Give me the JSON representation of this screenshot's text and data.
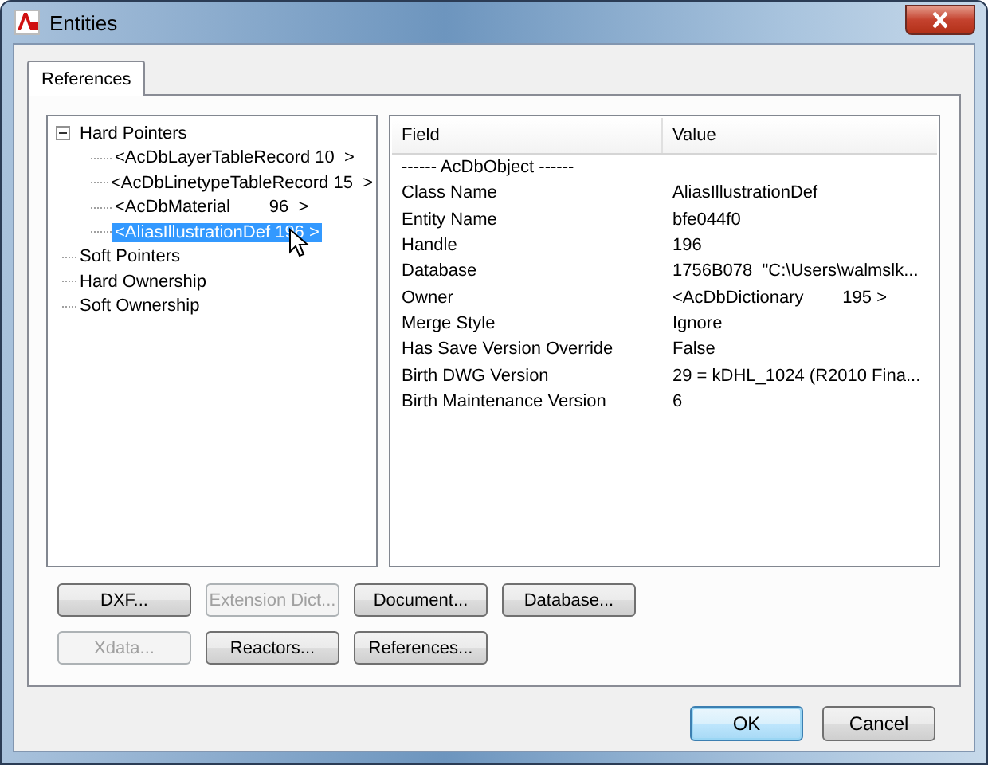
{
  "window": {
    "title": "Entities"
  },
  "tabs": [
    {
      "label": "References",
      "selected": true
    }
  ],
  "tree": [
    {
      "label": "Hard Pointers",
      "expanded": true,
      "selected": false,
      "children": [
        {
          "label": "<AcDbLayerTableRecord 10  >",
          "selected": false
        },
        {
          "label": "<AcDbLinetypeTableRecord 15  >",
          "selected": false
        },
        {
          "label": "<AcDbMaterial        96  >",
          "selected": false
        },
        {
          "label": "<AliasIllustrationDef 196 >",
          "selected": true
        }
      ]
    },
    {
      "label": "Soft Pointers",
      "selected": false
    },
    {
      "label": "Hard Ownership",
      "selected": false
    },
    {
      "label": "Soft Ownership",
      "selected": false
    }
  ],
  "table": {
    "columns": [
      "Field",
      "Value"
    ],
    "rows": [
      {
        "kind": "section",
        "cells": [
          "------ AcDbObject ------"
        ]
      },
      {
        "kind": "pair",
        "cells": [
          "Class Name",
          "AliasIllustrationDef"
        ]
      },
      {
        "kind": "pair",
        "cells": [
          "Entity Name",
          "bfe044f0"
        ]
      },
      {
        "kind": "pair",
        "cells": [
          "Handle",
          "196"
        ]
      },
      {
        "kind": "pair",
        "cells": [
          "Database",
          "1756B078  \"C:\\Users\\walmslk..."
        ]
      },
      {
        "kind": "pair",
        "cells": [
          "Owner",
          "<AcDbDictionary        195 >"
        ]
      },
      {
        "kind": "pair",
        "cells": [
          "Merge Style",
          "Ignore"
        ]
      },
      {
        "kind": "pair",
        "cells": [
          "Has Save Version Override",
          "False"
        ]
      },
      {
        "kind": "pair",
        "cells": [
          "Birth DWG Version",
          "29 = kDHL_1024 (R2010 Fina..."
        ]
      },
      {
        "kind": "pair",
        "cells": [
          "Birth Maintenance Version",
          "6"
        ]
      }
    ]
  },
  "action_rows": [
    [
      {
        "label": "DXF...",
        "disabled": false
      },
      {
        "label": "Extension Dict...",
        "disabled": true
      },
      {
        "label": "Document...",
        "disabled": false
      },
      {
        "label": "Database...",
        "disabled": false
      }
    ],
    [
      {
        "label": "Xdata...",
        "disabled": true
      },
      {
        "label": "Reactors...",
        "disabled": false
      },
      {
        "label": "References...",
        "disabled": false
      }
    ]
  ],
  "dialog_buttons": [
    {
      "label": "OK",
      "default": true
    },
    {
      "label": "Cancel",
      "default": false
    }
  ]
}
